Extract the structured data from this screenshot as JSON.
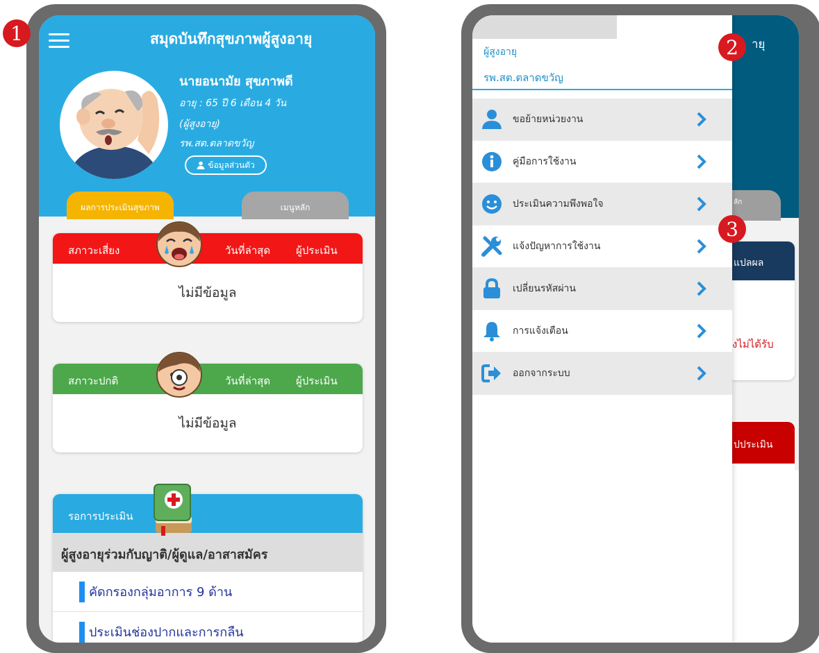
{
  "left": {
    "app_title": "สมุดบันทึกสุขภาพผู้สูงอายุ",
    "user": {
      "name": "นายอนามัย สุขภาพดี",
      "age": "อายุ : 65 ปี 6 เดือน 4 วัน",
      "group": "(ผู้สูงอายุ)",
      "unit": "รพ.สต.ตลาดขวัญ",
      "profile_button": "ข้อมูลส่วนตัว"
    },
    "tabs": {
      "results": "ผลการประเมินสุขภาพ",
      "main_menu": "เมนูหลัก"
    },
    "risk_card": {
      "status": "สภาวะเสี่ยง",
      "date": "วันที่ล่าสุด",
      "assessor": "ผู้ประเมิน",
      "body": "ไม่มีข้อมูล",
      "color": "#f21616"
    },
    "normal_card": {
      "status": "สภาวะปกติ",
      "date": "วันที่ล่าสุด",
      "assessor": "ผู้ประเมิน",
      "body": "ไม่มีข้อมูล",
      "color": "#4ca84a"
    },
    "pending": {
      "header": "รอการประเมิน",
      "subheader": "ผู้สูงอายุร่วมกับญาติ/ผู้ดูแล/อาสาสมัคร",
      "items": [
        "คัดกรองกลุ่มอาการ 9 ด้าน",
        "ประเมินช่องปากและการกลืน"
      ]
    }
  },
  "badges": [
    "1",
    "2",
    "3"
  ],
  "right": {
    "role": "ผู้สูงอายุ",
    "unit": "รพ.สต.ตลาดขวัญ",
    "menu": [
      {
        "label": "ขอย้ายหน่วยงาน",
        "icon": "user-icon"
      },
      {
        "label": "คู่มือการใช้งาน",
        "icon": "info-icon"
      },
      {
        "label": "ประเมินความพึงพอใจ",
        "icon": "smiley-icon"
      },
      {
        "label": "แจ้งปัญหาการใช้งาน",
        "icon": "tools-icon"
      },
      {
        "label": "เปลี่ยนรหัสผ่าน",
        "icon": "lock-icon"
      },
      {
        "label": "การแจ้งเตือน",
        "icon": "bell-icon"
      },
      {
        "label": "ออกจากระบบ",
        "icon": "logout-icon"
      }
    ],
    "background_peek": {
      "title_fragment": "ายุ",
      "tab_fragment": "ลัก",
      "card1_header": "แปลผล",
      "card1_text": "งไม่ได้รับ",
      "card2_header": "ปประเมิน"
    }
  },
  "colors": {
    "header_blue": "#29abe2",
    "menu_icon_blue": "#2a8fd8",
    "badge_red": "#d71920"
  }
}
